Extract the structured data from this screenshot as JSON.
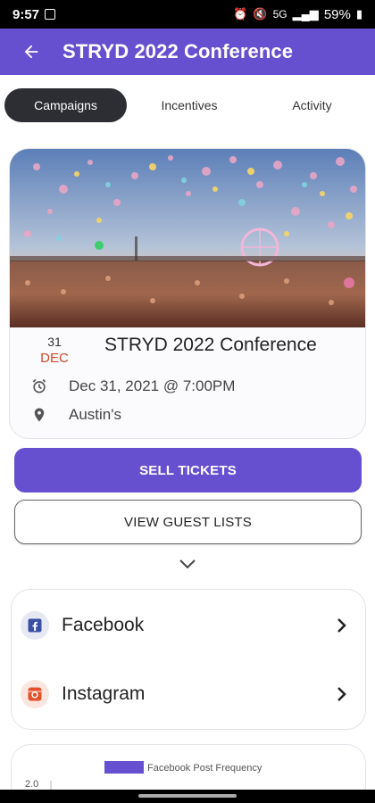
{
  "status_bar": {
    "time": "9:57",
    "network": "5G",
    "battery": "59%"
  },
  "header": {
    "title": "STRYD 2022 Conference",
    "back_icon": "arrow-left-icon"
  },
  "tabs": [
    {
      "label": "Campaigns",
      "active": true
    },
    {
      "label": "Incentives",
      "active": false
    },
    {
      "label": "Activity",
      "active": false
    }
  ],
  "event": {
    "image": "concert-crowd-with-balloons",
    "day": "31",
    "month": "DEC",
    "title": "STRYD 2022 Conference",
    "datetime": "Dec 31, 2021 @ 7:00PM",
    "location": "Austin's"
  },
  "buttons": {
    "sell_tickets": "SELL TICKETS",
    "view_guest_lists": "VIEW GUEST LISTS"
  },
  "social": [
    {
      "label": "Facebook",
      "icon": "facebook-icon",
      "color": "#3b4fa6"
    },
    {
      "label": "Instagram",
      "icon": "instagram-icon",
      "color": "#e4502a"
    }
  ],
  "chart_data": {
    "type": "bar",
    "series": [
      {
        "name": "Facebook Post Frequency",
        "values": []
      }
    ],
    "y_ticks": [
      "2.0"
    ],
    "legend_color": "#6650cf"
  },
  "colors": {
    "primary": "#6650cf",
    "dark_tab": "#2d2e34",
    "month": "#d4472a"
  }
}
